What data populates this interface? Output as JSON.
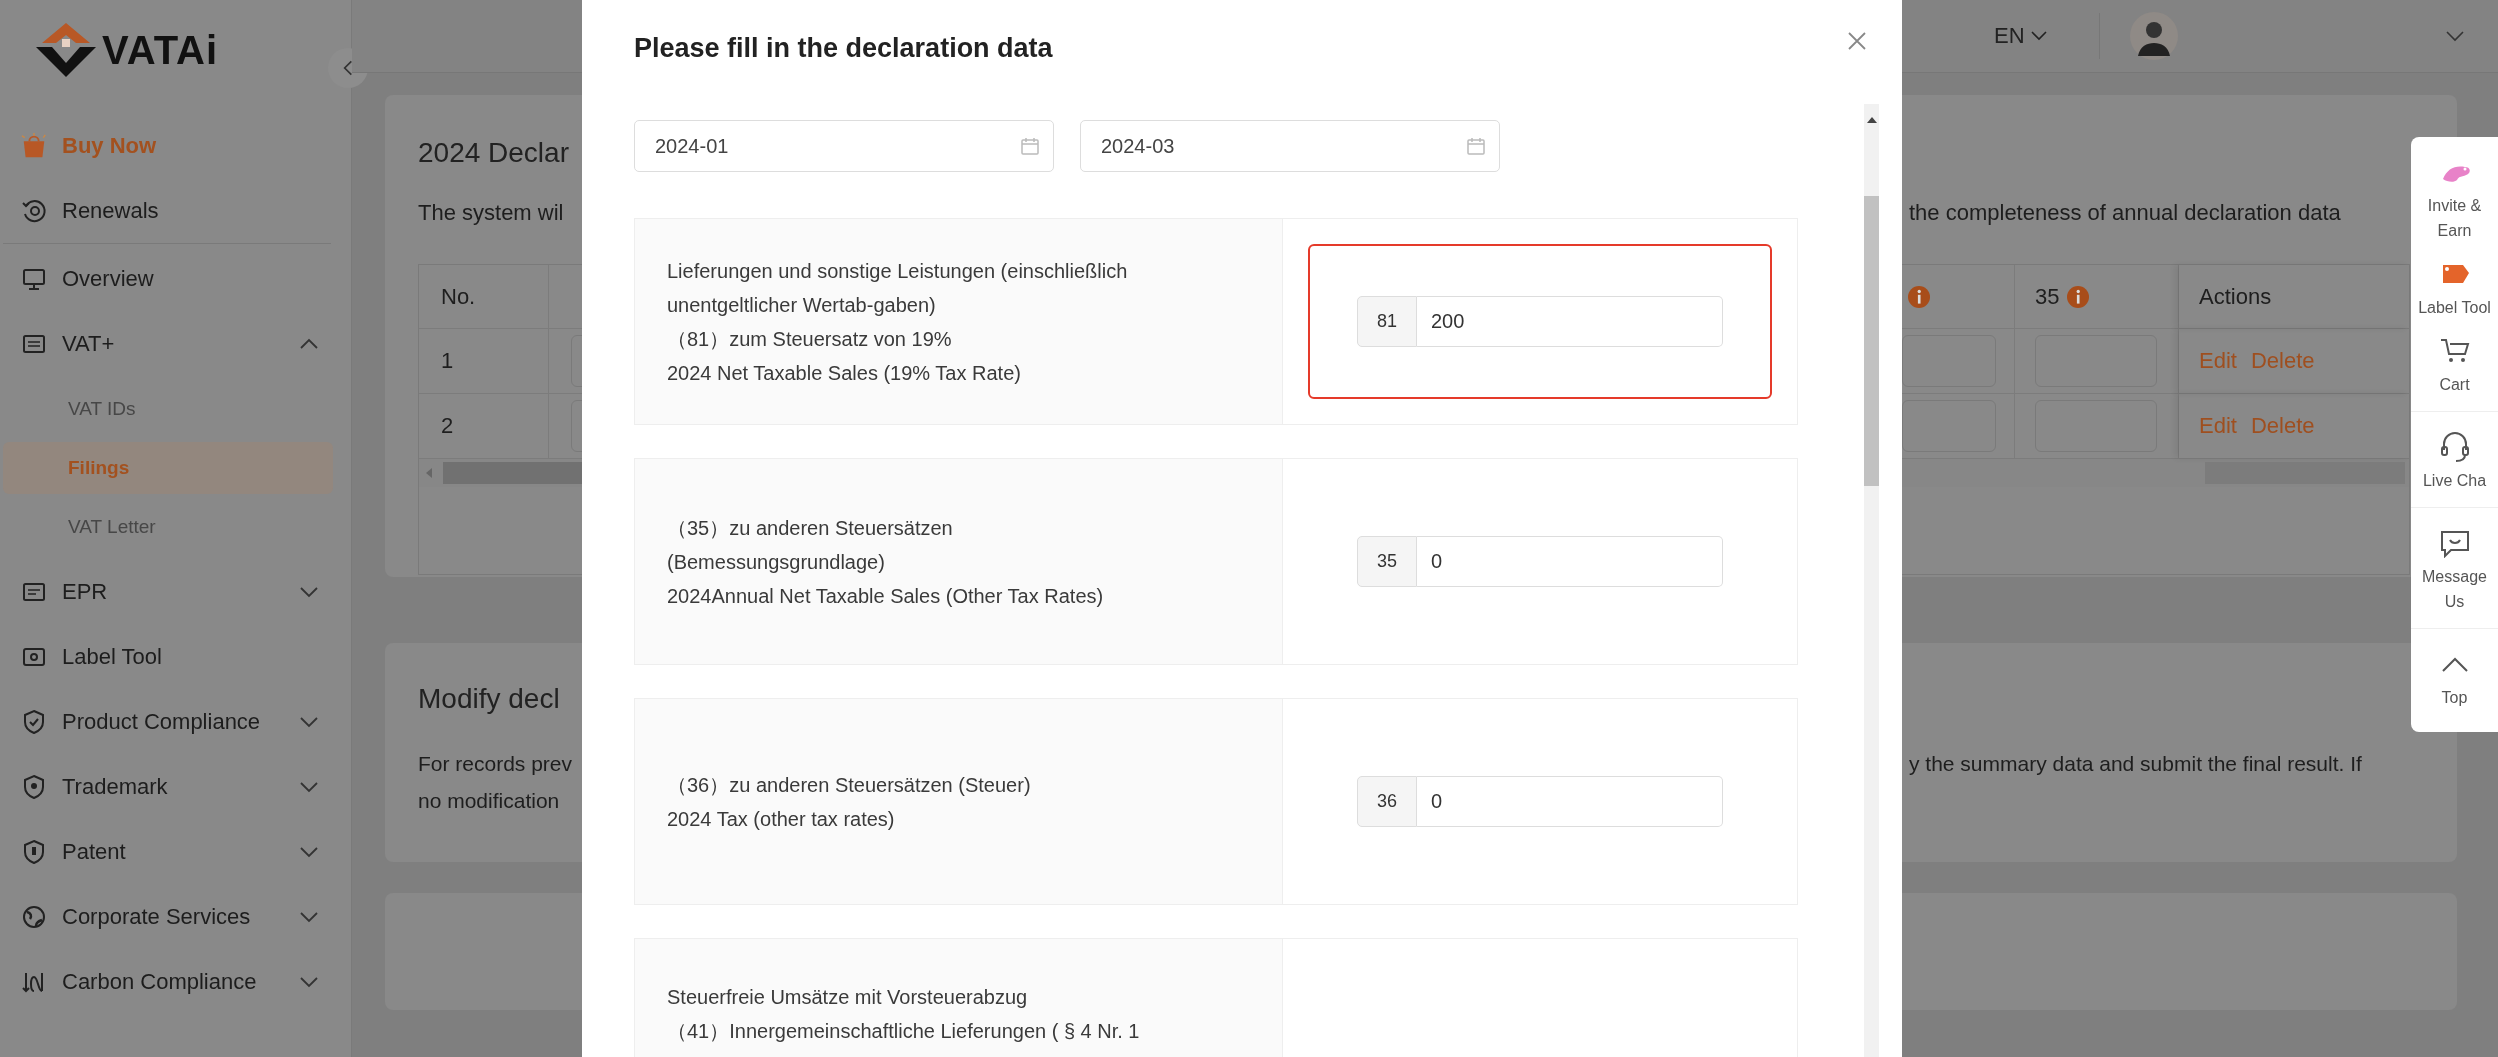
{
  "sidebar": {
    "logo": "VATAi",
    "top_items": [
      {
        "label": "Buy Now",
        "kind": "promo"
      },
      {
        "label": "Renewals",
        "kind": "link"
      }
    ],
    "items": [
      {
        "label": "Overview",
        "kind": "link"
      },
      {
        "label": "VAT+",
        "kind": "group",
        "expanded": true,
        "children": [
          {
            "label": "VAT IDs",
            "selected": false
          },
          {
            "label": "Filings",
            "selected": true
          },
          {
            "label": "VAT Letter",
            "selected": false
          }
        ]
      },
      {
        "label": "EPR",
        "kind": "group",
        "expanded": false
      },
      {
        "label": "Label Tool",
        "kind": "link"
      },
      {
        "label": "Product Compliance",
        "kind": "group",
        "expanded": false
      },
      {
        "label": "Trademark",
        "kind": "group",
        "expanded": false
      },
      {
        "label": "Patent",
        "kind": "group",
        "expanded": false
      },
      {
        "label": "Corporate Services",
        "kind": "group",
        "expanded": false
      },
      {
        "label": "Carbon Compliance",
        "kind": "group",
        "expanded": false
      }
    ]
  },
  "header": {
    "language": "EN"
  },
  "declaration_card": {
    "title_start": "2024 Declar",
    "intro_start": "The system wil",
    "intro_end": "the completeness of annual declaration data",
    "columns_left": [
      "No."
    ],
    "columns_right": [
      {
        "label": "35",
        "info": true
      },
      {
        "label": "Actions",
        "info": false
      }
    ],
    "rows": [
      {
        "no": "1",
        "actions": [
          "Edit",
          "Delete"
        ]
      },
      {
        "no": "2",
        "actions": [
          "Edit",
          "Delete"
        ]
      }
    ]
  },
  "modify_card": {
    "title_start": "Modify decl",
    "text_left": [
      "For records prev",
      "no modification"
    ],
    "text_right": "y the summary data and submit the final result. If"
  },
  "modal": {
    "title": "Please fill in the declaration data",
    "date_from": "2024-01",
    "date_to": "2024-03",
    "rows": [
      {
        "lines": [
          "Lieferungen und sonstige Leistungen (einschließlich",
          "unentgeltlicher  Wertab-gaben)",
          "（81）zum Steuersatz von 19%",
          "2024 Net Taxable Sales (19% Tax Rate)"
        ],
        "code": "81",
        "value": "200",
        "highlighted": true
      },
      {
        "lines": [
          "（35）zu anderen Steuersätzen",
          "(Bemessungsgrundlage)",
          "2024Annual Net Taxable Sales (Other Tax Rates)"
        ],
        "code": "35",
        "value": "0",
        "highlighted": false
      },
      {
        "lines": [
          "（36）zu anderen Steuersätzen (Steuer)",
          "2024 Tax (other tax rates)"
        ],
        "code": "36",
        "value": "0",
        "highlighted": false
      },
      {
        "lines": [
          "Steuerfreie Umsätze mit Vorsteuerabzug",
          "（41）Innergemeinschaftliche Lieferungen ( § 4 Nr. 1"
        ],
        "highlighted": false
      }
    ]
  },
  "float_panel": {
    "items": [
      {
        "label": "Invite & Earn"
      },
      {
        "label": "Label Tool"
      },
      {
        "label": "Cart"
      },
      {
        "label": "Live Cha"
      },
      {
        "label": "Message Us"
      },
      {
        "label": "Top"
      }
    ]
  }
}
